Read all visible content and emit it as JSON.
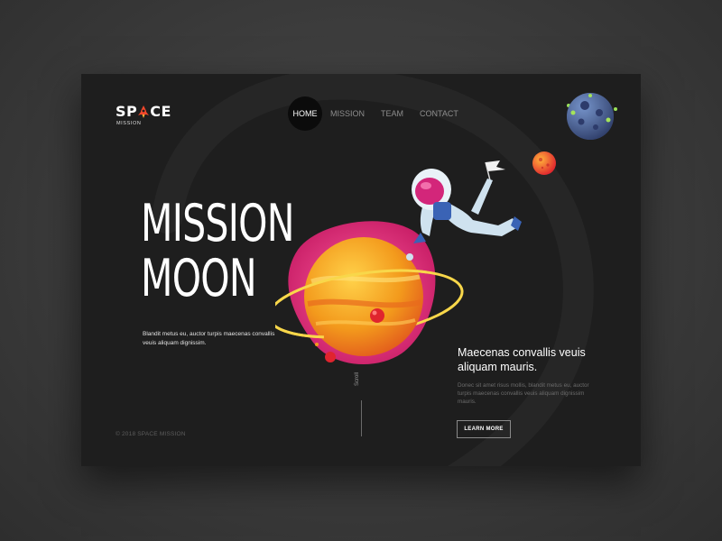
{
  "brand": {
    "name_prefix": "SP",
    "name_suffix": "CE",
    "tagline": "MISSION"
  },
  "nav": {
    "items": [
      "HOME",
      "MISSION",
      "TEAM",
      "CONTACT"
    ],
    "active": "HOME"
  },
  "hero": {
    "title_line1": "MISSION",
    "title_line2": "MOON",
    "description": "Blandit metus eu, auctor turpis maecenas convallis veuis aliquam dignissim."
  },
  "side": {
    "heading": "Maecenas convallis veuis aliquam mauris.",
    "description": "Donec sit amet risus mollis, blandit metus eu, auctor turpis maecenas convallis veuis aliquam dignissim mauris.",
    "button_label": "LEARN MORE"
  },
  "scroll_label": "Scroll",
  "footer": {
    "copyright": "© 2018 SPACE MISSION"
  },
  "colors": {
    "page_bg": "#3b3b3b",
    "card_bg": "#1e1e1e",
    "text_primary": "#ffffff",
    "text_muted": "#6c6c6c",
    "accent_pink": "#e0337a",
    "accent_orange": "#f39a1c",
    "accent_red": "#e0242e",
    "logo_rocket": "#f2472b"
  },
  "icons": {
    "logo": "rocket-icon",
    "illustration": [
      "astronaut",
      "ringed-planet",
      "small-red-planet",
      "blue-moon"
    ]
  }
}
